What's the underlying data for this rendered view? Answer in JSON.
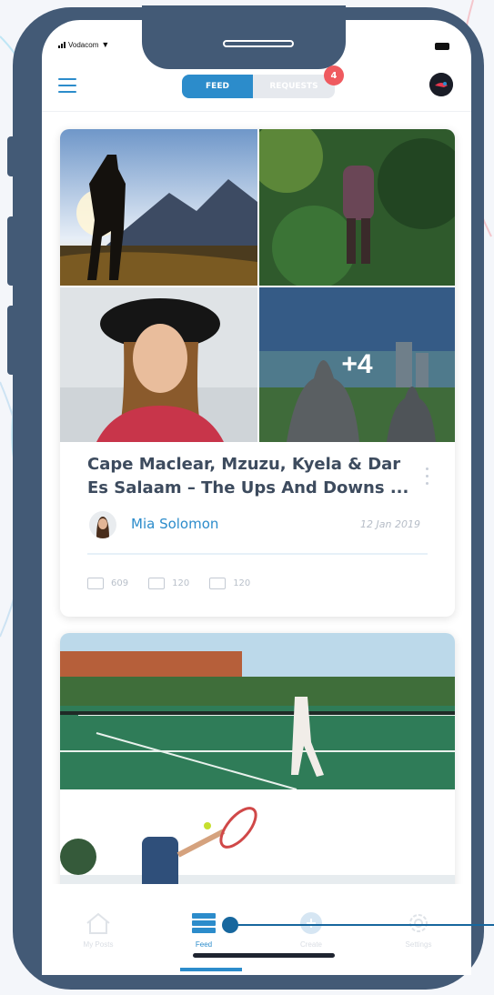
{
  "status_bar": {
    "carrier": "Vodacom"
  },
  "header": {
    "tabs": [
      {
        "label": "FEED",
        "active": true
      },
      {
        "label": "REQUESTS",
        "active": false
      }
    ],
    "requests_badge": "4"
  },
  "post": {
    "more_count": "+4",
    "title": "Cape Maclear, Mzuzu, Kyela & Dar Es Salaam – The Ups And Downs ...",
    "author": "Mia Solomon",
    "date": "12 Jan 2019",
    "stats": {
      "photos": "609",
      "videos": "120",
      "audio": "120"
    }
  },
  "tabbar": {
    "items": [
      {
        "label": "My Posts",
        "icon": "home-icon"
      },
      {
        "label": "Feed",
        "icon": "feed-list-icon",
        "active": true
      },
      {
        "label": "Create",
        "icon": "plus-circle-icon"
      },
      {
        "label": "Settings",
        "icon": "gear-icon"
      }
    ]
  },
  "colors": {
    "frame": "#435a76",
    "accent": "#2c8ccb",
    "badge": "#ef5a5f",
    "title": "#3d4b5e"
  }
}
